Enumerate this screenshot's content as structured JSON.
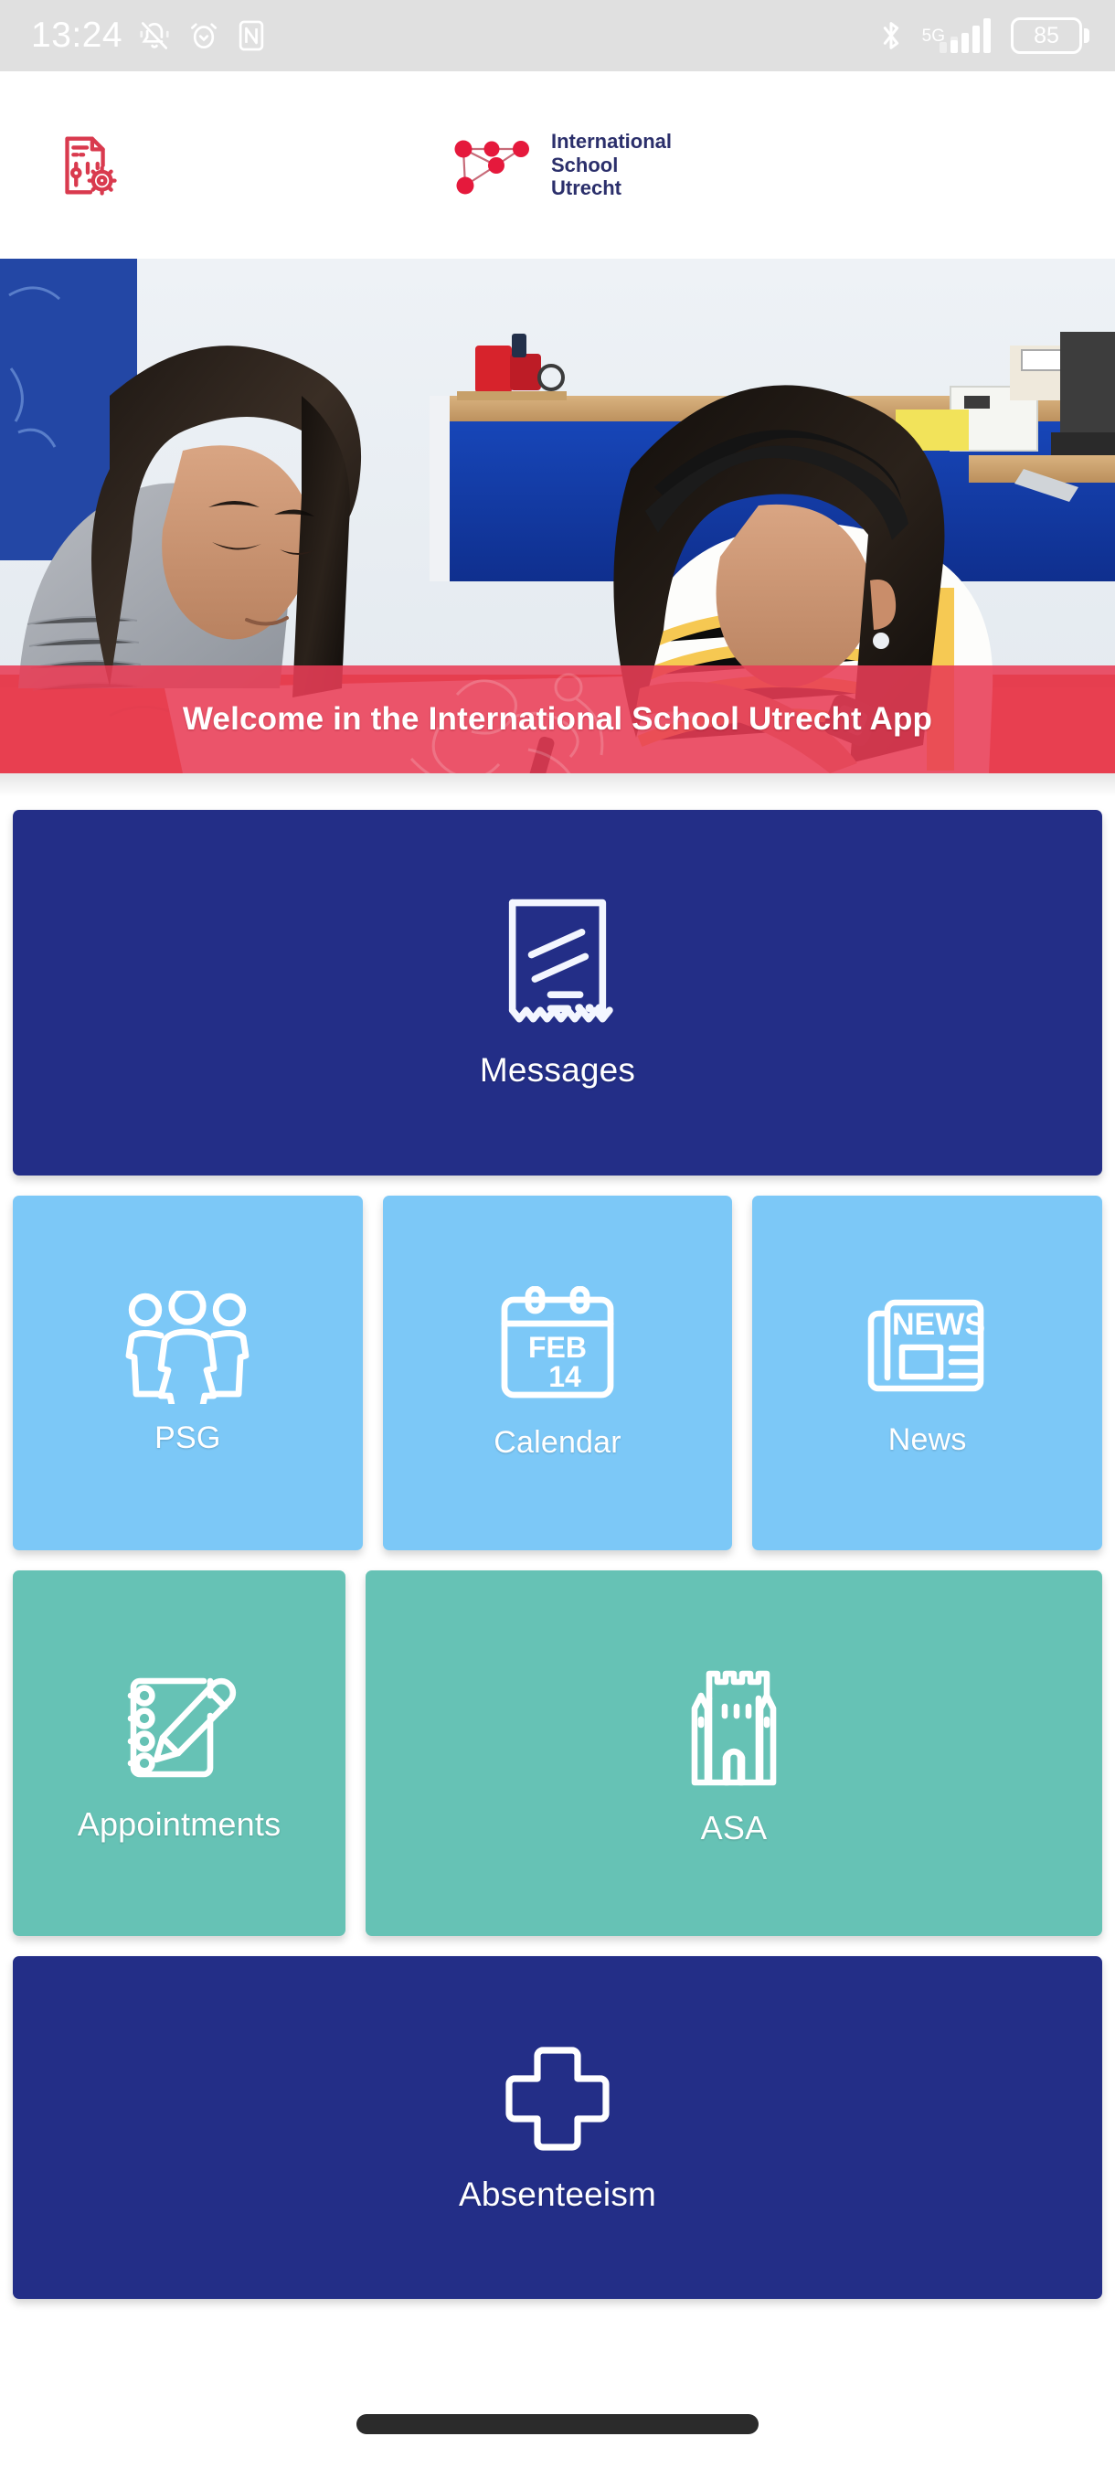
{
  "status_bar": {
    "time": "13:24",
    "battery_percent": "85",
    "network_type": "5G",
    "icons": [
      "mute-icon",
      "alarm-icon",
      "nfc-icon",
      "bluetooth-icon",
      "signal-icon",
      "battery-icon"
    ]
  },
  "header": {
    "settings_icon": "document-settings-icon",
    "brand": {
      "line1": "International",
      "line2": "School",
      "line3": "Utrecht",
      "logo_icon": "network-nodes-logo"
    }
  },
  "hero": {
    "banner_text": "Welcome in the International School Utrecht App",
    "photo_alt": "two-students-writing-photo"
  },
  "tiles": [
    {
      "label": "Messages",
      "icon": "receipt-message-icon",
      "color": "#232e87",
      "span": "full"
    },
    {
      "label": "PSG",
      "icon": "three-people-icon",
      "color": "#7cc8f7",
      "span": "third"
    },
    {
      "label": "Calendar",
      "icon": "calendar-icon",
      "icon_text_month": "FEB",
      "icon_text_day": "14",
      "color": "#7cc8f7",
      "span": "third"
    },
    {
      "label": "News",
      "icon": "newspaper-icon",
      "icon_text": "NEWS",
      "color": "#7cc8f7",
      "span": "third"
    },
    {
      "label": "Appointments",
      "icon": "notebook-pencil-icon",
      "color": "#66c2b5",
      "span": "third"
    },
    {
      "label": "ASA",
      "icon": "castle-tower-icon",
      "color": "#66c2b5",
      "span": "two-thirds"
    },
    {
      "label": "Absenteeism",
      "icon": "medical-cross-icon",
      "color": "#232e87",
      "span": "full"
    }
  ],
  "colors": {
    "navy": "#232e87",
    "sky_blue": "#7cc8f7",
    "teal": "#66c2b5",
    "banner_red": "#e83c55",
    "brand_red": "#e03048",
    "status_bar_bg": "#e0e0e0"
  },
  "navigation_bar": {
    "gesture_pill": "home-gesture-indicator"
  }
}
